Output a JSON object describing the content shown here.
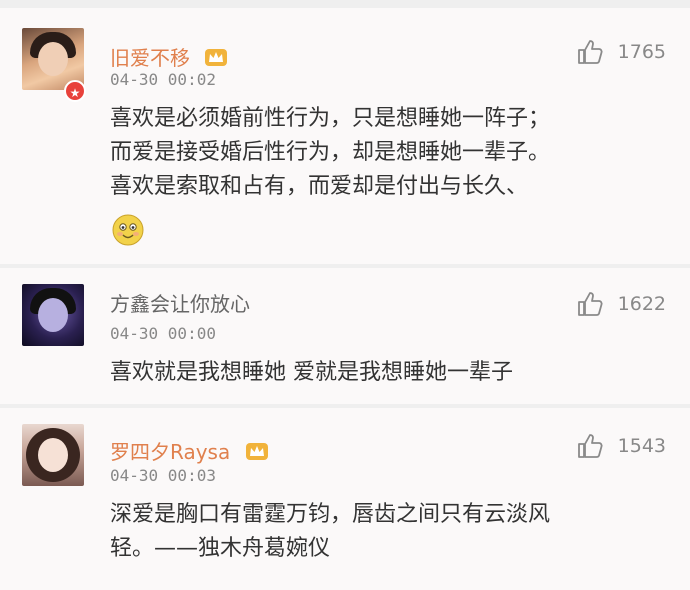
{
  "comments": [
    {
      "username": "旧爱不移",
      "timestamp": "04-30 00:02",
      "likes": "1765",
      "text_lines": [
        "喜欢是必须婚前性行为，只是想睡她一阵子；",
        "而爱是接受婚后性行为，却是想睡她一辈子。",
        "喜欢是索取和占有，而爱却是付出与长久、"
      ],
      "has_crown": true,
      "has_v_badge": true,
      "emoji": "smile-emoji"
    },
    {
      "username": "方鑫会让你放心",
      "timestamp": "04-30 00:00",
      "likes": "1622",
      "text_lines": [
        "喜欢就是我想睡她 爱就是我想睡她一辈子"
      ],
      "has_crown": false
    },
    {
      "username": "罗四夕Raysa",
      "timestamp": "04-30 00:03",
      "likes": "1543",
      "text_lines": [
        "深爱是胸口有雷霆万钧，唇齿之间只有云淡风",
        "轻。——独木舟葛婉仪"
      ],
      "has_crown": true
    }
  ],
  "colors": {
    "username_vip": "#e0804d",
    "username_normal": "#666666",
    "meta": "#888888",
    "card_bg": "#fbf9f9",
    "page_bg": "#efefef"
  },
  "icons": {
    "like": "thumbs-up-icon",
    "crown": "crown-icon",
    "verified": "v-badge-icon"
  }
}
